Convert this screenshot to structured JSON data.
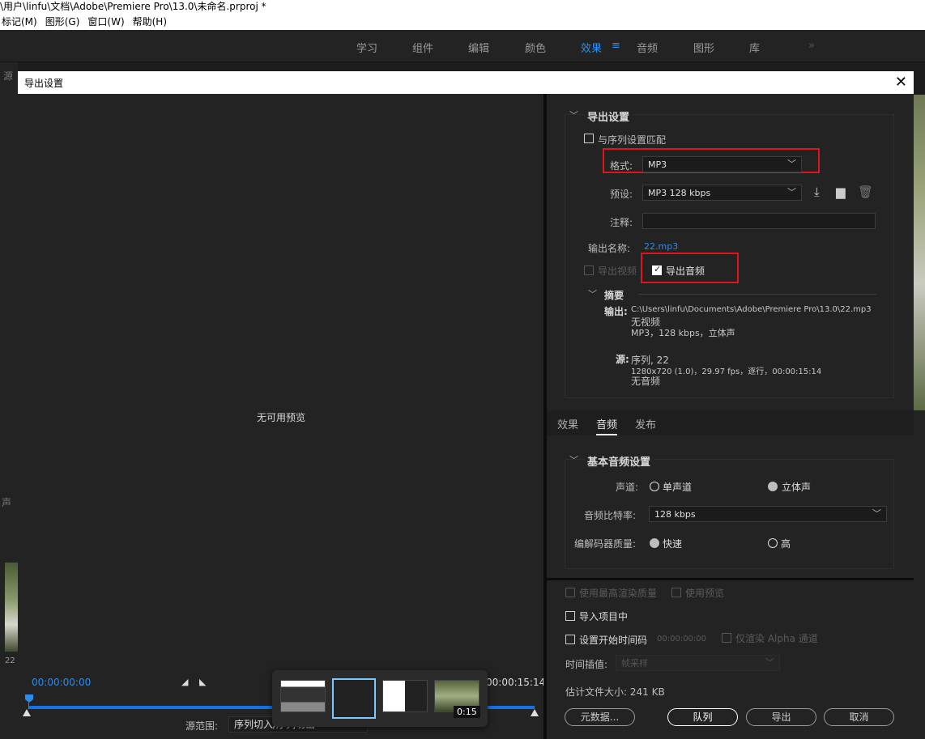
{
  "window": {
    "title": "\\用户\\linfu\\文档\\Adobe\\Premiere Pro\\13.0\\未命名.prproj *"
  },
  "menubar": [
    "标记(M)",
    "图形(G)",
    "窗口(W)",
    "帮助(H)"
  ],
  "workspace_tabs": [
    {
      "label": "学习"
    },
    {
      "label": "组件"
    },
    {
      "label": "编辑"
    },
    {
      "label": "颜色"
    },
    {
      "label": "效果",
      "active": true
    },
    {
      "label": "音频"
    },
    {
      "label": "图形"
    },
    {
      "label": "库"
    }
  ],
  "workspace_menu_icon": "≡",
  "workspace_overflow": "»",
  "left_bg": {
    "source_label": "源",
    "audio_label": "声",
    "num": "22"
  },
  "dialog": {
    "title": "导出设置",
    "close_label": "✕"
  },
  "preview": {
    "no_preview": "无可用预览",
    "timecode_in": "00:00:00:00",
    "timecode_out": "00:00:15:14",
    "source_range_label": "源范围:",
    "source_range_value": "序列切入/序列切出"
  },
  "taskbar": {
    "thumb_time": "0:15"
  },
  "export_settings": {
    "section_title": "导出设置",
    "match_sequence": "与序列设置匹配",
    "format_label": "格式:",
    "format_value": "MP3",
    "preset_label": "预设:",
    "preset_value": "MP3 128 kbps",
    "comment_label": "注释:",
    "comment_value": "",
    "output_name_label": "输出名称:",
    "output_name_value": "22.mp3",
    "export_video": "导出视频",
    "export_audio": "导出音频",
    "summary_title": "摘要",
    "output_label": "输出:",
    "output_path": "C:\\Users\\linfu\\Documents\\Adobe\\Premiere Pro\\13.0\\22.mp3",
    "output_line2": "无视频",
    "output_line3": "MP3，128 kbps，立体声",
    "source_label": "源:",
    "source_line1": "序列, 22",
    "source_line2": "1280x720 (1.0)，29.97 fps，逐行，00:00:15:14",
    "source_line3": "无音频"
  },
  "tabs": [
    {
      "label": "效果"
    },
    {
      "label": "音频",
      "active": true
    },
    {
      "label": "发布"
    }
  ],
  "audio_settings": {
    "section_title": "基本音频设置",
    "channel_label": "声道:",
    "mono": "单声道",
    "stereo": "立体声",
    "bitrate_label": "音频比特率:",
    "bitrate_value": "128 kbps",
    "codec_quality_label": "编解码器质量:",
    "fast": "快速",
    "high": "高"
  },
  "bottom": {
    "max_render": "使用最高渲染质量",
    "use_previews": "使用预览",
    "import_project": "导入项目中",
    "set_start_tc": "设置开始时间码",
    "start_tc_value": "00:00:00:00",
    "render_alpha": "仅渲染 Alpha 通道",
    "time_interp_label": "时间插值:",
    "time_interp_value": "帧采样",
    "est_size": "估计文件大小: 241 KB",
    "buttons": {
      "metadata": "元数据...",
      "queue": "队列",
      "export": "导出",
      "cancel": "取消"
    }
  }
}
